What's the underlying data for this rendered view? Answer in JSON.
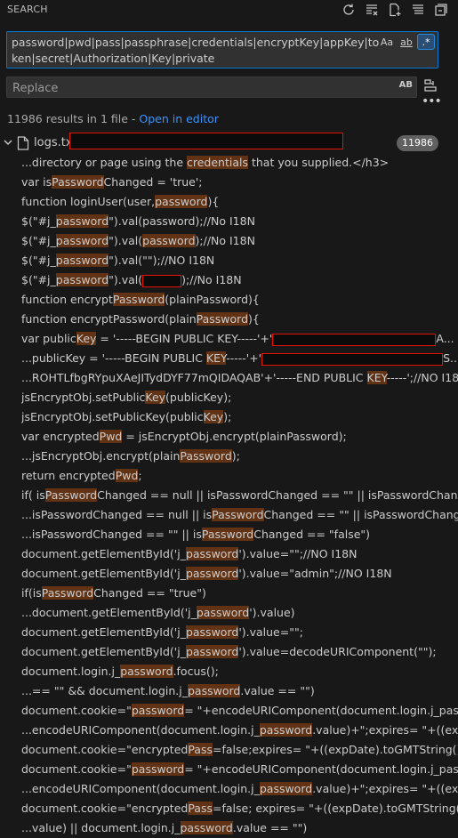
{
  "header": {
    "title": "SEARCH",
    "icons": [
      "refresh-icon",
      "clear-results-icon",
      "new-search-editor-icon",
      "view-as-tree-icon",
      "collapse-all-icon"
    ]
  },
  "search": {
    "query": "password|pwd|pass|passphrase|credentials|encryptKey|appKey|token|secret|Authorization|Key|private",
    "options": [
      {
        "label": "Aa",
        "name": "match-case",
        "active": false
      },
      {
        "label": "ab",
        "name": "match-whole-word",
        "active": false
      },
      {
        "label": ".*",
        "name": "use-regex",
        "active": true
      }
    ]
  },
  "replace": {
    "placeholder": "Replace",
    "preserve_case_label": "AB"
  },
  "summary": {
    "text": "11986 results in 1 file - ",
    "link": "Open in editor"
  },
  "file": {
    "name": "logs.txt",
    "count": "11986"
  },
  "colors": {
    "match_highlight": "#613214",
    "accent": "#0078d4",
    "link": "#3794ff",
    "redaction": "#e51400"
  },
  "results": [
    [
      "...directory or page using the ",
      {
        "m": "credentials"
      },
      " that you supplied.</h3>"
    ],
    [
      "var is",
      {
        "m": "Password"
      },
      "Changed = 'true';"
    ],
    [
      "function loginUser(user,",
      {
        "m": "password"
      },
      "){"
    ],
    [
      "$(\"#j_",
      {
        "m": "password"
      },
      "\").val(password);//No I18N"
    ],
    [
      "$(\"#j_",
      {
        "m": "password"
      },
      "\").val(",
      {
        "m": "password"
      },
      ");//No I18N"
    ],
    [
      "$(\"#j_",
      {
        "m": "password"
      },
      "\").val(\"\");//NO I18N"
    ],
    [
      "$(\"#j_",
      {
        "m": "password"
      },
      "\").val(",
      {
        "r": 44
      },
      ");//No I18N"
    ],
    [
      "function encrypt",
      {
        "m": "Password"
      },
      "(plainPassword){"
    ],
    [
      "function encryptPassword(plain",
      {
        "m": "Password"
      },
      "){"
    ],
    [
      "var public",
      {
        "m": "Key"
      },
      " = '-----BEGIN PUBLIC KEY-----'+'",
      {
        "r": 184
      },
      "A..."
    ],
    [
      "...publicKey = '-----BEGIN PUBLIC ",
      {
        "m": "KEY"
      },
      "-----'+'",
      {
        "r": 204
      },
      "S..."
    ],
    [
      "...ROHTLfbgRYpuXAeJITydDYF77mQIDAQAB'+'-----END PUBLIC ",
      {
        "m": "KEY"
      },
      "-----';//NO I18N"
    ],
    [
      "jsEncryptObj.setPublic",
      {
        "m": "Key"
      },
      "(publicKey);"
    ],
    [
      "jsEncryptObj.setPublicKey(public",
      {
        "m": "Key"
      },
      ");"
    ],
    [
      "var encrypted",
      {
        "m": "Pwd"
      },
      " = jsEncryptObj.encrypt(plainPassword);"
    ],
    [
      "...jsEncryptObj.encrypt(plain",
      {
        "m": "Password"
      },
      ");"
    ],
    [
      "return encrypted",
      {
        "m": "Pwd"
      },
      ";"
    ],
    [
      "if( is",
      {
        "m": "Password"
      },
      "Changed == null || isPasswordChanged == \"\" || isPasswordChanged ..."
    ],
    [
      "...isPasswordChanged == null || is",
      {
        "m": "Password"
      },
      "Changed == \"\" || isPasswordChanged =..."
    ],
    [
      "...isPasswordChanged == \"\" || is",
      {
        "m": "Password"
      },
      "Changed == \"false\")"
    ],
    [
      "document.getElementById('j_",
      {
        "m": "password"
      },
      "').value=\"\";//NO I18N"
    ],
    [
      "document.getElementById('j_",
      {
        "m": "password"
      },
      "').value=\"admin\";//NO I18N"
    ],
    [
      "if(is",
      {
        "m": "Password"
      },
      "Changed == \"true\")"
    ],
    [
      "...document.getElementById('j_",
      {
        "m": "password"
      },
      "').value)"
    ],
    [
      "document.getElementById('j_",
      {
        "m": "password"
      },
      "').value=\"\";"
    ],
    [
      "document.getElementById('j_",
      {
        "m": "password"
      },
      "').value=decodeURIComponent(\"\");"
    ],
    [
      "document.login.j_",
      {
        "m": "password"
      },
      ".focus();"
    ],
    [
      "...== \"\" && document.login.j_",
      {
        "m": "password"
      },
      ".value == \"\")"
    ],
    [
      "document.cookie=\"",
      {
        "m": "password"
      },
      "= \"+encodeURIComponent(document.login.j_passw..."
    ],
    [
      "...encodeURIComponent(document.login.j_",
      {
        "m": "password"
      },
      ".value)+\";expires= \"+((expDat..."
    ],
    [
      "document.cookie=\"encrypted",
      {
        "m": "Pass"
      },
      "=false;expires= \"+((expDate).toGMTString());"
    ],
    [
      "document.cookie=\"",
      {
        "m": "password"
      },
      "= \"+encodeURIComponent(document.login.j_passw..."
    ],
    [
      "...encodeURIComponent(document.login.j_",
      {
        "m": "password"
      },
      ".value)+\";expires= \"+((expDat..."
    ],
    [
      "document.cookie=\"encrypted",
      {
        "m": "Pass"
      },
      "=false; expires= \"+((expDate).toGMTString());"
    ],
    [
      "...value) || document.login.j_",
      {
        "m": "password"
      },
      ".value == \"\")"
    ]
  ]
}
